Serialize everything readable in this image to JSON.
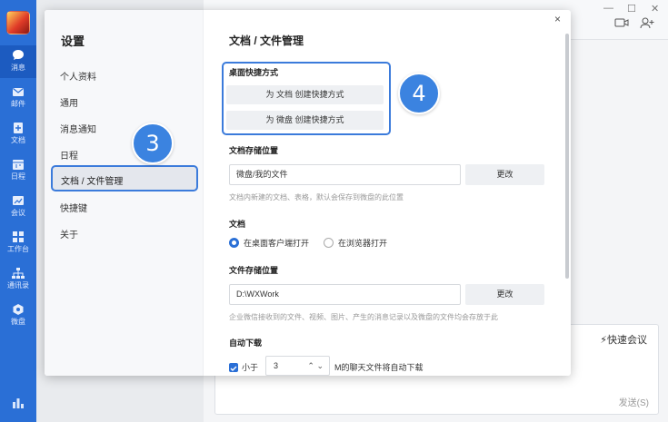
{
  "rail": {
    "items": [
      {
        "label": "消息",
        "icon": "chat-icon"
      },
      {
        "label": "邮件",
        "icon": "mail-icon"
      },
      {
        "label": "文档",
        "icon": "document-icon"
      },
      {
        "label": "日程",
        "icon": "calendar-icon"
      },
      {
        "label": "会议",
        "icon": "meeting-icon"
      },
      {
        "label": "工作台",
        "icon": "workbench-icon"
      },
      {
        "label": "通讯录",
        "icon": "contacts-icon"
      },
      {
        "label": "微盘",
        "icon": "drive-icon"
      }
    ]
  },
  "background": {
    "quick_meeting": "快速会议",
    "send": "发送(S)"
  },
  "settings": {
    "title": "设置",
    "menu": [
      "个人资料",
      "通用",
      "消息通知",
      "日程",
      "文档 / 文件管理",
      "快捷键",
      "关于"
    ],
    "active_menu": "文档 / 文件管理",
    "close": "×"
  },
  "content": {
    "title": "文档 / 文件管理",
    "desktop_shortcut": {
      "title": "桌面快捷方式",
      "doc_button": "为 文档 创建快捷方式",
      "drive_button": "为 微盘 创建快捷方式"
    },
    "doc_storage": {
      "title": "文档存储位置",
      "value": "微盘/我的文件",
      "change": "更改",
      "hint": "文档内新建的文档、表格，默认会保存到微盘的此位置"
    },
    "doc_open": {
      "title": "文档",
      "option1": "在桌面客户端打开",
      "option2": "在浏览器打开",
      "selected": "在桌面客户端打开"
    },
    "file_storage": {
      "title": "文件存储位置",
      "value": "D:\\WXWork",
      "change": "更改",
      "hint": "企业微信接收到的文件、视频、图片、产生的消息记录以及微盘的文件均会存放于此"
    },
    "auto_download": {
      "title": "自动下载",
      "less_than": "小于",
      "value": "3",
      "suffix": "M的聊天文件将自动下载",
      "arrows": "⌃ ⌄"
    }
  },
  "badges": {
    "step3": "3",
    "step4": "4"
  },
  "colors": {
    "accent": "#2a6fd6",
    "badge": "#3b83e0"
  }
}
